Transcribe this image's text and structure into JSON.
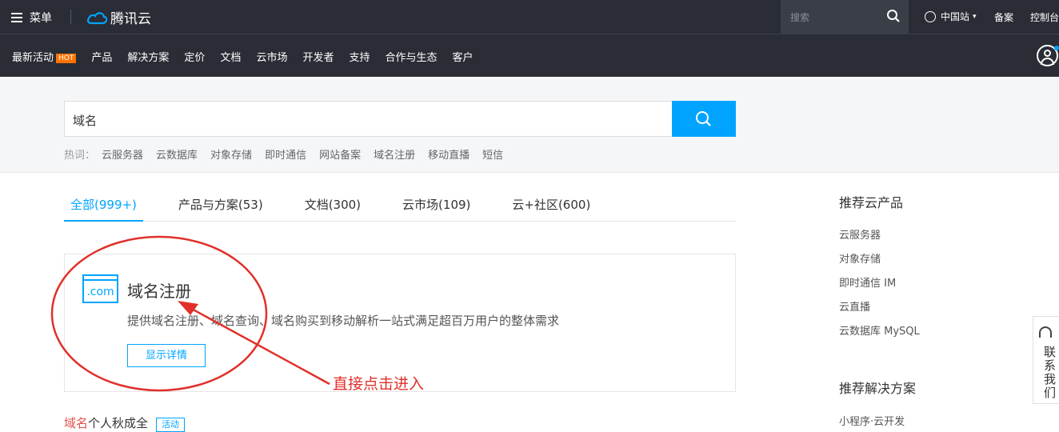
{
  "topbar": {
    "menu_label": "菜单",
    "logo_text": "腾讯云",
    "search_placeholder": "搜索",
    "region": "中国站",
    "beian": "备案",
    "console": "控制台"
  },
  "nav": {
    "items": [
      "最新活动",
      "产品",
      "解决方案",
      "定价",
      "文档",
      "云市场",
      "开发者",
      "支持",
      "合作与生态",
      "客户"
    ],
    "hot_badge": "HOT"
  },
  "search": {
    "query": "域名",
    "hot_label": "热词：",
    "hot_words": [
      "云服务器",
      "云数据库",
      "对象存储",
      "即时通信",
      "网站备案",
      "域名注册",
      "移动直播",
      "短信"
    ]
  },
  "tabs": [
    "全部(999+)",
    "产品与方案(53)",
    "文档(300)",
    "云市场(109)",
    "云+社区(600)"
  ],
  "result": {
    "icon_text": ".com",
    "title": "域名注册",
    "description": "提供域名注册、域名查询、域名购买到移动解析一站式满足超百万用户的整体需求",
    "button": "显示详情"
  },
  "next_result": {
    "title_highlight": "域名",
    "title_rest": "个人秋成全",
    "tag": "活动"
  },
  "annotation": {
    "text": "直接点击进入",
    "color": "#e1302a"
  },
  "sidebar": {
    "products_title": "推荐云产品",
    "products": [
      "云服务器",
      "对象存储",
      "即时通信 IM",
      "云直播",
      "云数据库 MySQL"
    ],
    "solutions_title": "推荐解决方案",
    "solutions": [
      "小程序·云开发"
    ]
  },
  "contact": {
    "label": "联系我们"
  },
  "colors": {
    "accent": "#00a4ff",
    "header_bg": "#2a2d35",
    "hot": "#ff7200"
  }
}
